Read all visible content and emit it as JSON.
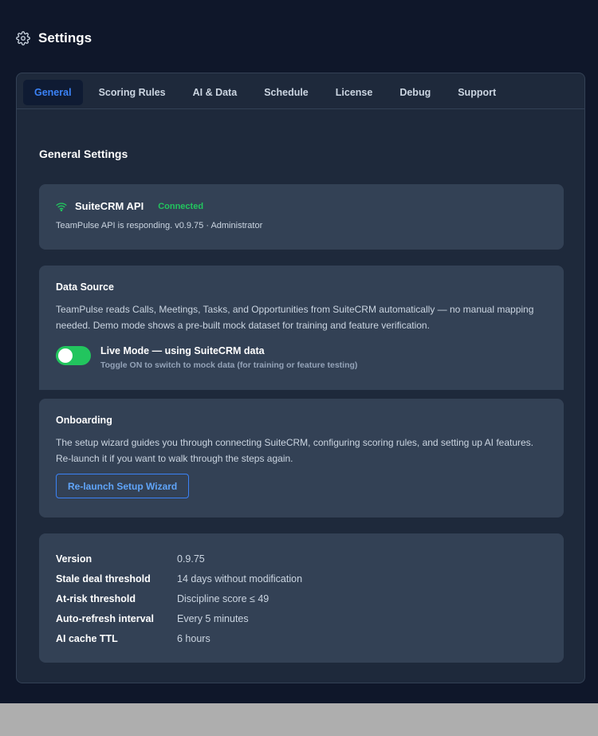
{
  "header": {
    "title": "Settings",
    "icon": "gear-icon"
  },
  "tabs": [
    {
      "label": "General",
      "active": true
    },
    {
      "label": "Scoring Rules",
      "active": false
    },
    {
      "label": "AI & Data",
      "active": false
    },
    {
      "label": "Schedule",
      "active": false
    },
    {
      "label": "License",
      "active": false
    },
    {
      "label": "Debug",
      "active": false
    },
    {
      "label": "Support",
      "active": false
    }
  ],
  "general": {
    "title": "General Settings",
    "api": {
      "name": "SuiteCRM API",
      "status": "Connected",
      "status_color": "#22c55e",
      "subtitle": "TeamPulse API is responding. v0.9.75 · Administrator",
      "icon": "wifi-icon"
    },
    "data_source": {
      "title": "Data Source",
      "description": "TeamPulse reads Calls, Meetings, Tasks, and Opportunities from SuiteCRM automatically — no manual mapping needed. Demo mode shows a pre-built mock dataset for training and feature verification.",
      "toggle_label": "Live Mode — using SuiteCRM data",
      "toggle_hint": "Toggle ON to switch to mock data (for training or feature testing)",
      "toggle_on": true
    },
    "onboarding": {
      "title": "Onboarding",
      "description": "The setup wizard guides you through connecting SuiteCRM, configuring scoring rules, and setting up AI features. Re-launch it if you want to walk through the steps again.",
      "button_label": "Re-launch Setup Wizard"
    },
    "info": [
      {
        "key": "Version",
        "value": "0.9.75"
      },
      {
        "key": "Stale deal threshold",
        "value": "14 days without modification"
      },
      {
        "key": "At-risk threshold",
        "value": "Discipline score ≤ 49"
      },
      {
        "key": "Auto-refresh interval",
        "value": "Every 5 minutes"
      },
      {
        "key": "AI cache TTL",
        "value": "6 hours"
      }
    ]
  },
  "colors": {
    "accent": "#3b82f6",
    "success": "#22c55e",
    "background": "#0f172a",
    "card": "#334155"
  }
}
